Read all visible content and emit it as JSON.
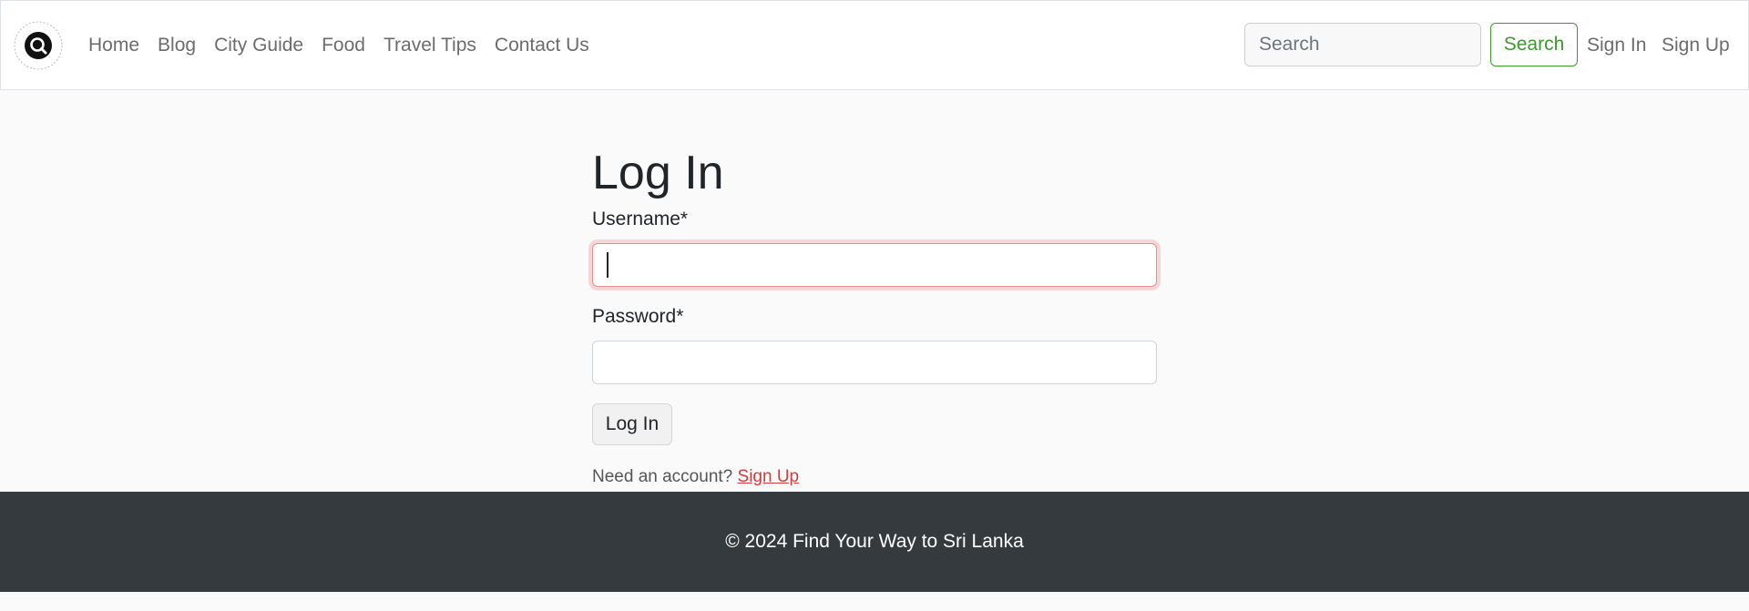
{
  "nav": {
    "logo_icon": "find-your-way-logo-icon",
    "links": [
      "Home",
      "Blog",
      "City Guide",
      "Food",
      "Travel Tips",
      "Contact Us"
    ],
    "search": {
      "placeholder": "Search",
      "value": "",
      "button_label": "Search"
    },
    "sign_in": "Sign In",
    "sign_up": "Sign Up"
  },
  "form": {
    "title": "Log In",
    "username_label": "Username*",
    "username_value": "",
    "password_label": "Password*",
    "password_value": "",
    "submit_label": "Log In",
    "account_prompt": "Need an account?",
    "account_link": "Sign Up"
  },
  "footer": {
    "text": "© 2024 Find Your Way to Sri Lanka"
  },
  "colors": {
    "accent_green": "#3a9a2a",
    "link_red": "#d63a3a",
    "footer_bg": "#353a3e"
  }
}
